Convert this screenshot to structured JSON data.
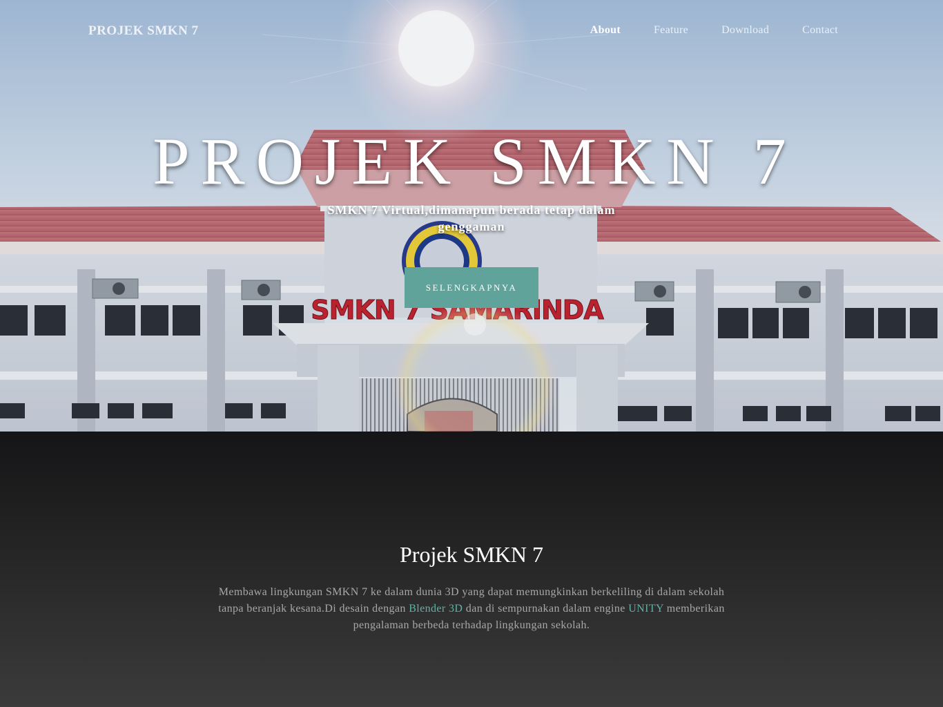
{
  "nav": {
    "brand": "PROJEK SMKN 7",
    "links": [
      "About",
      "Feature",
      "Download",
      "Contact"
    ]
  },
  "hero": {
    "title": "PROJEK SMKN 7",
    "subtitle": "SMKN 7 Virtual,dimanapun berada tetap dalam genggaman",
    "button": "SELENGKAPNYA",
    "building_sign": "SMKN 7 SAMARINDA"
  },
  "about": {
    "title": "Projek SMKN 7",
    "text_1": "Membawa lingkungan SMKN 7 ke dalam dunia 3D yang dapat memungkinkan berkeliling di dalam sekolah tanpa beranjak kesana.Di desain dengan ",
    "highlight_1": "Blender 3D",
    "text_2": " dan di sempurnakan dalam engine ",
    "highlight_2": "UNITY",
    "text_3": " memberikan pengalaman berbeda terhadap lingkungan sekolah."
  },
  "colors": {
    "accent": "#5fa39a",
    "highlight_text": "#5fb3a6",
    "dark_bg": "#1e1e1e"
  }
}
